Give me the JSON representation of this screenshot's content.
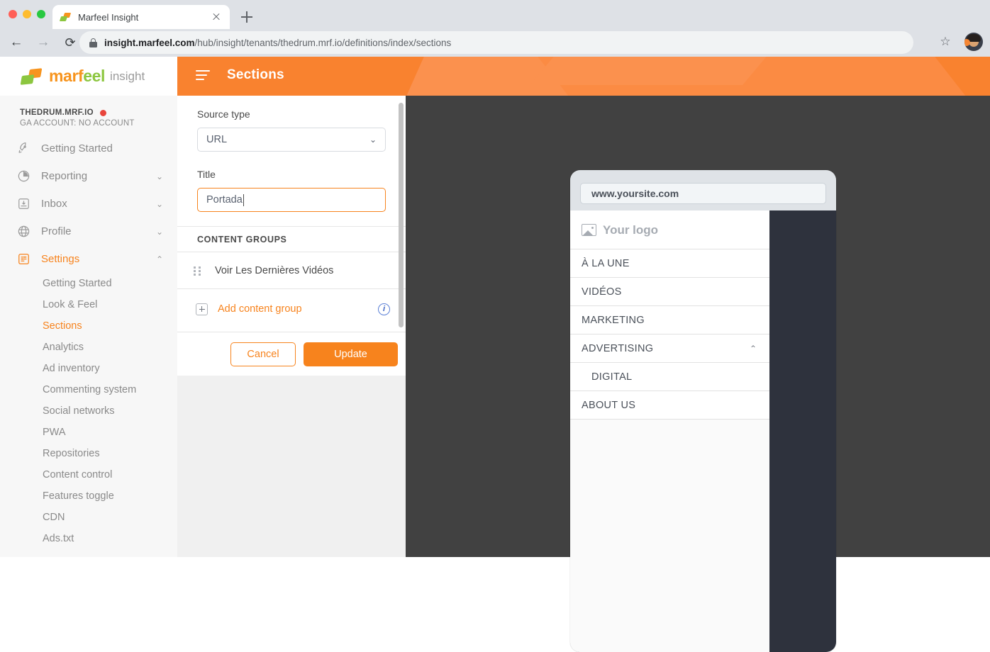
{
  "browser": {
    "tab_title": "Marfeel Insight",
    "url_host": "insight.marfeel.com",
    "url_path": "/hub/insight/tenants/thedrum.mrf.io/definitions/index/sections",
    "back_glyph": "←",
    "forward_glyph": "→",
    "reload_glyph": "⟳",
    "star_glyph": "☆"
  },
  "sidebar": {
    "logo": {
      "word_a": "marf",
      "word_b": "eel",
      "sub": "insight"
    },
    "account": {
      "name": "THEDRUM.MRF.IO",
      "ga": "GA ACCOUNT: NO ACCOUNT"
    },
    "nav": [
      {
        "label": "Getting Started",
        "icon": "rocket-icon",
        "chevron": "",
        "active": false
      },
      {
        "label": "Reporting",
        "icon": "pie-chart-icon",
        "chevron": "⌄",
        "active": false
      },
      {
        "label": "Inbox",
        "icon": "inbox-icon",
        "chevron": "⌄",
        "active": false
      },
      {
        "label": "Profile",
        "icon": "globe-icon",
        "chevron": "⌄",
        "active": false
      },
      {
        "label": "Settings",
        "icon": "settings-list-icon",
        "chevron": "⌃",
        "active": true
      }
    ],
    "settings_sub": [
      {
        "label": "Getting Started",
        "active": false
      },
      {
        "label": "Look & Feel",
        "active": false
      },
      {
        "label": "Sections",
        "active": true
      },
      {
        "label": "Analytics",
        "active": false
      },
      {
        "label": "Ad inventory",
        "active": false
      },
      {
        "label": "Commenting system",
        "active": false
      },
      {
        "label": "Social networks",
        "active": false
      },
      {
        "label": "PWA",
        "active": false
      },
      {
        "label": "Repositories",
        "active": false
      },
      {
        "label": "Content control",
        "active": false
      },
      {
        "label": "Features toggle",
        "active": false
      },
      {
        "label": "CDN",
        "active": false
      },
      {
        "label": "Ads.txt",
        "active": false
      }
    ]
  },
  "topbar": {
    "title": "Sections"
  },
  "form": {
    "source_type": {
      "label": "Source type",
      "value": "URL",
      "chevron": "⌄"
    },
    "title": {
      "label": "Title",
      "value": "Portada",
      "placeholder": "Title"
    },
    "content_groups_header": "CONTENT GROUPS",
    "content_groups": [
      {
        "name": "Voir Les Dernières Vidéos"
      }
    ],
    "add_content_group": "Add content group",
    "info_glyph": "i",
    "cancel_label": "Cancel",
    "update_label": "Update"
  },
  "preview": {
    "url": "www.yoursite.com",
    "logo_label": "Your logo",
    "menu": [
      {
        "label": "À LA UNE",
        "chevron": "",
        "sub": false
      },
      {
        "label": "VIDÉOS",
        "chevron": "",
        "sub": false
      },
      {
        "label": "MARKETING",
        "chevron": "",
        "sub": false
      },
      {
        "label": "ADVERTISING",
        "chevron": "⌃",
        "sub": false
      },
      {
        "label": "DIGITAL",
        "chevron": "",
        "sub": true
      },
      {
        "label": "ABOUT US",
        "chevron": "",
        "sub": false
      }
    ]
  },
  "colors": {
    "brand_orange": "#f7831d",
    "header_orange": "#f9822f",
    "brand_green": "#8cc63f",
    "preview_bg": "#414141",
    "overlay": "#2e323d",
    "status_red": "#e8453c"
  }
}
